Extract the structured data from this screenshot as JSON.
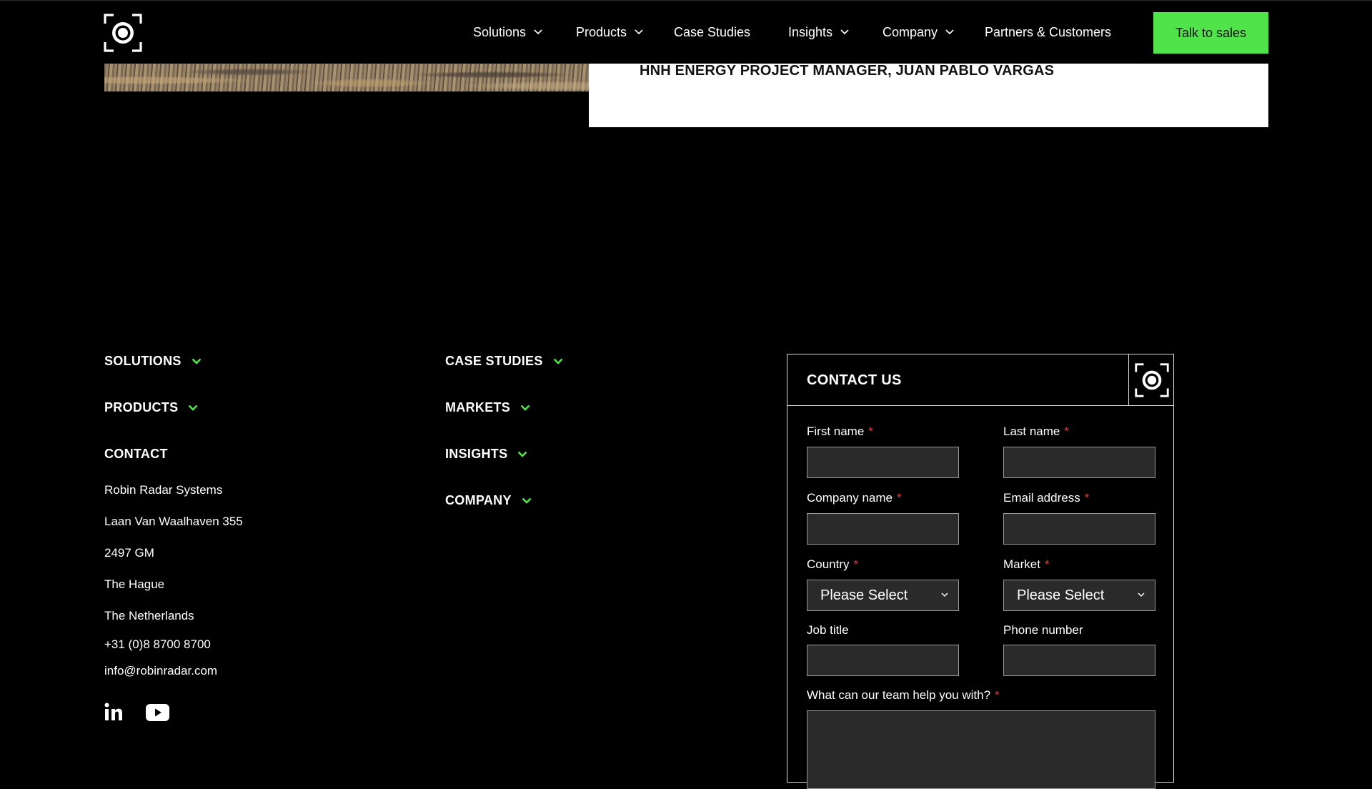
{
  "header": {
    "logo": "robin-radar-logo-icon",
    "nav": [
      {
        "label": "Solutions",
        "has_dropdown": true
      },
      {
        "label": "Products",
        "has_dropdown": true
      },
      {
        "label": "Case Studies",
        "has_dropdown": false
      },
      {
        "label": "Insights",
        "has_dropdown": true
      },
      {
        "label": "Company",
        "has_dropdown": true
      },
      {
        "label": "Partners & Customers",
        "has_dropdown": false
      }
    ],
    "cta_label": "Talk to sales"
  },
  "testimonial": {
    "author": "HNH ENERGY PROJECT MANAGER, JUAN PABLO VARGAS"
  },
  "footer": {
    "nav_left": [
      "SOLUTIONS",
      "PRODUCTS"
    ],
    "nav_right": [
      "CASE STUDIES",
      "MARKETS",
      "INSIGHTS",
      "COMPANY"
    ],
    "contact": {
      "title": "CONTACT",
      "company": "Robin Radar Systems",
      "street": "Laan Van Waalhaven 355",
      "postcode": "2497 GM",
      "city": "The Hague",
      "country": "The Netherlands",
      "phone": "+31 (0)8 8700 8700",
      "email": "info@robinradar.com"
    },
    "social": [
      "linkedin-icon",
      "youtube-icon"
    ]
  },
  "form": {
    "title": "CONTACT US",
    "required_marker": "*",
    "first_name": "First name",
    "last_name": "Last name",
    "company_name": "Company name",
    "email": "Email address",
    "country": "Country",
    "market": "Market",
    "select_placeholder": "Please Select",
    "job_title": "Job title",
    "phone": "Phone number",
    "help": "What can our team help you with?"
  },
  "colors": {
    "accent_green": "#50e44a",
    "background": "#000000",
    "required_red": "#e43a3a"
  }
}
